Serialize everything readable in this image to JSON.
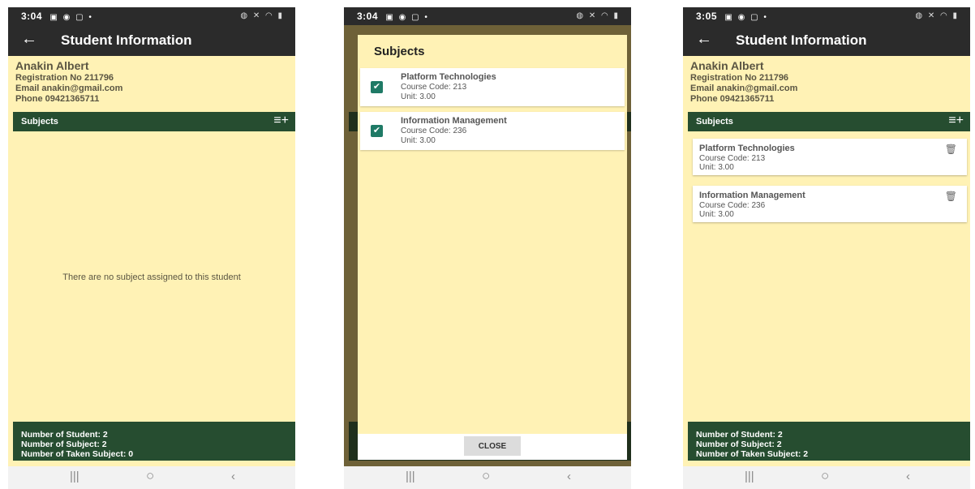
{
  "icons": {
    "back": "arrow-left-icon",
    "add": "playlist-add-icon",
    "trash": "trash-icon",
    "check": "check-icon"
  },
  "colors": {
    "background": "#fff2b5",
    "app_bar": "#2b2b2b",
    "accent_green": "#264d30",
    "checkbox": "#1f7a66"
  },
  "student": {
    "name": "Anakin Albert",
    "registration": "Registration No 211796",
    "email": "Email anakin@gmail.com",
    "phone": "Phone 09421365711"
  },
  "screens": [
    {
      "status_time": "3:04",
      "title": "Student Information",
      "subjects_label": "Subjects",
      "empty_message": "There are no subject assigned to this student",
      "footer": {
        "students": "Number of Student: 2",
        "subjects": "Number of Subject: 2",
        "taken": "Number of Taken Subject: 0"
      }
    },
    {
      "status_time": "3:04",
      "dialog_title": "Subjects",
      "options": [
        {
          "name": "Platform Technologies",
          "code": "Course Code: 213",
          "unit": "Unit: 3.00",
          "checked": true
        },
        {
          "name": "Information Management",
          "code": "Course Code: 236",
          "unit": "Unit: 3.00",
          "checked": true
        }
      ],
      "close_label": "CLOSE"
    },
    {
      "status_time": "3:05",
      "title": "Student Information",
      "subjects_label": "Subjects",
      "items": [
        {
          "name": "Platform Technologies",
          "code": "Course Code: 213",
          "unit": "Unit: 3.00"
        },
        {
          "name": "Information Management",
          "code": "Course Code: 236",
          "unit": "Unit: 3.00"
        }
      ],
      "footer": {
        "students": "Number of Student: 2",
        "subjects": "Number of Subject: 2",
        "taken": "Number of Taken Subject: 2"
      }
    }
  ]
}
